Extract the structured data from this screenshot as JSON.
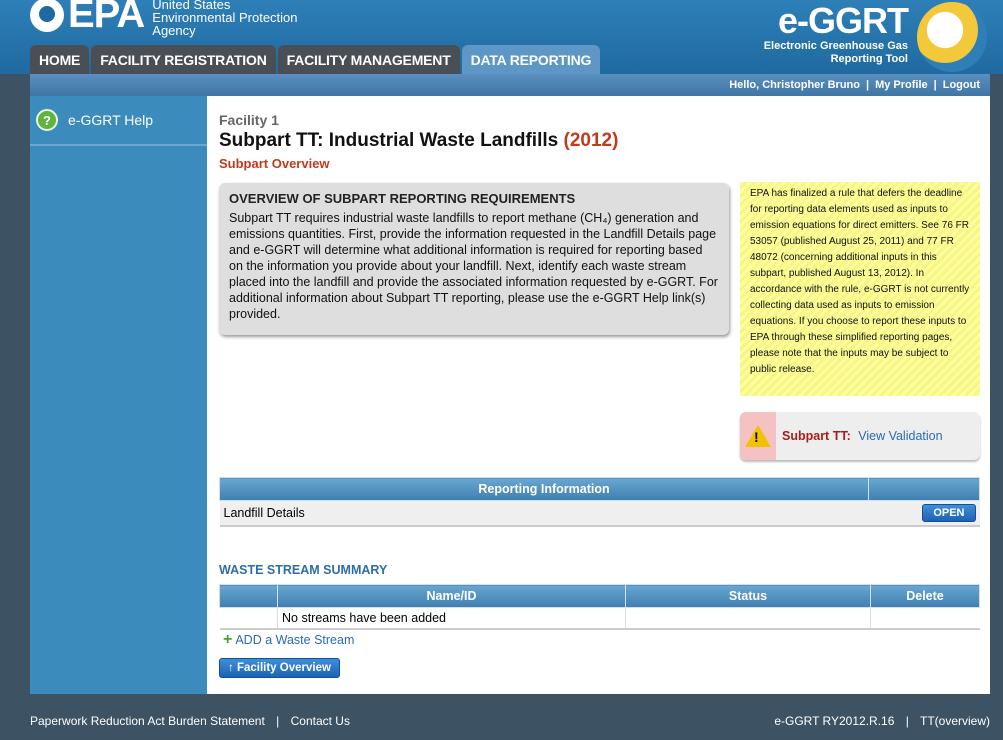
{
  "header": {
    "epa_logo_text": "EPA",
    "agency_lines": [
      "United States",
      "Environmental Protection",
      "Agency"
    ],
    "brand_title": "e-GGRT",
    "brand_sub": [
      "Electronic Greenhouse Gas",
      "Reporting Tool"
    ]
  },
  "tabs": [
    {
      "label": "HOME",
      "active": false
    },
    {
      "label": "FACILITY REGISTRATION",
      "active": false
    },
    {
      "label": "FACILITY MANAGEMENT",
      "active": false
    },
    {
      "label": "DATA REPORTING",
      "active": true
    }
  ],
  "userbar": {
    "greeting": "Hello, Christopher Bruno",
    "separator": "|",
    "my_profile": "My Profile",
    "logout": "Logout"
  },
  "sidebar": {
    "help": "e-GGRT Help"
  },
  "main": {
    "facility": "Facility 1",
    "title": "Subpart TT: Industrial Waste Landfills",
    "year": "(2012)",
    "subtitle": "Subpart Overview",
    "overview_heading": "OVERVIEW OF SUBPART REPORTING REQUIREMENTS",
    "overview_text": "Subpart TT requires industrial waste landfills to report methane (CH₄) generation and emissions quantities. First, provide the information requested in the Landfill Details page and e-GGRT will determine what additional information is required for reporting based on the information you provide about your landfill. Next, identify each waste stream placed into the landfill and provide the associated information requested by e-GGRT. For additional information about Subpart TT reporting, please use the e-GGRT Help link(s) provided.",
    "notice": "EPA has finalized a rule that defers the deadline for reporting data elements used as inputs to emission equations for direct emitters. See 76 FR 53057 (published August 25, 2011) and 77 FR 48072 (concerning additional inputs in this subpart, published August 13, 2012). In accordance with the rule, e-GGRT is not currently collecting data used as inputs to emission equations. If you choose to report these inputs to EPA through these simplified reporting pages, please note that the inputs may be subject to public release.",
    "validation_label": "Subpart TT:",
    "validation_link": "View Validation"
  },
  "reporting_table": {
    "header": "Reporting Information",
    "rows": [
      {
        "name": "Landfill Details",
        "action": "OPEN"
      }
    ]
  },
  "waste_stream": {
    "title": "WASTE STREAM SUMMARY",
    "columns": [
      "Name/ID",
      "Status",
      "Delete"
    ],
    "empty_text": "No streams have been added",
    "add_link": "ADD a Waste Stream"
  },
  "buttons": {
    "facility_overview": "Facility Overview"
  },
  "footer": {
    "paperwork": "Paperwork Reduction Act Burden Statement",
    "contact": "Contact Us",
    "version": "e-GGRT RY2012.R.16",
    "page_id": "TT(overview)",
    "separator": "|"
  }
}
